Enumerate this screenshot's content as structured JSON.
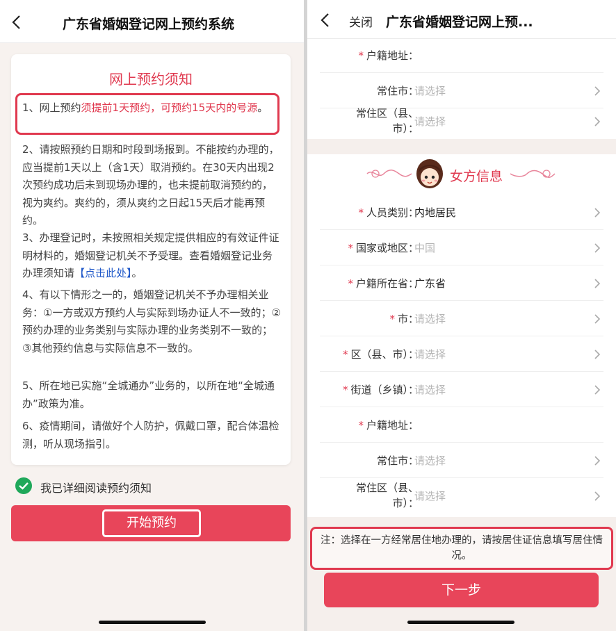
{
  "left": {
    "nav_title": "广东省婚姻登记网上预约系统",
    "notice_title": "网上预约须知",
    "rule1": {
      "prefix": "1、网上预约",
      "red1": "须提前1天预约",
      "comma": "，",
      "red2": "可预约15天内的号",
      "red3": "源",
      "suffix": "。"
    },
    "rule2": "2、请按照预约日期和时段到场报到。不能按约办理的，应当提前1天以上（含1天）取消预约。在30天内出现2次预约成功后未到现场办理的，也未提前取消预约的，视为爽约。爽约的，须从爽约之日起15天后才能再预约。",
    "rule3": {
      "text": "3、办理登记时，未按照相关规定提供相应的有效证件证明材料的，婚姻登记机关不予受理。查看婚姻登记业务办理须知请",
      "link": "【点击此处】",
      "end": "。"
    },
    "rule4": "4、有以下情形之一的，婚姻登记机关不予办理相关业务：①一方或双方预约人与实际到场办证人不一致的；②预约办理的业务类别与实际办理的业务类别不一致的；③其他预约信息与实际信息不一致的。",
    "rule5": "5、所在地已实施“全城通办”业务的，以所在地“全城通办”政策为准。",
    "rule6": "6、疫情期间，请做好个人防护，佩戴口罩，配合体温检测，听从现场指引。",
    "agree_text": "我已详细阅读预约须知",
    "start_button": "开始预约"
  },
  "right": {
    "close_label": "关闭",
    "nav_title": "广东省婚姻登记网上预...",
    "top_rows": [
      {
        "label": "户籍地址：",
        "required": "*",
        "value": "",
        "placeholder": false
      },
      {
        "label": "常住市：",
        "required": "",
        "value": "请选择",
        "placeholder": true
      },
      {
        "label_line1": "常住区（县、",
        "label_line2": "市）：",
        "required": "",
        "value": "请选择",
        "placeholder": true
      }
    ],
    "female_section_title": "女方信息",
    "female_rows": [
      {
        "label": "人员类别：",
        "required": "*",
        "value": "内地居民",
        "placeholder": false
      },
      {
        "label": "国家或地区：",
        "required": "*",
        "value": "中国",
        "placeholder": true
      },
      {
        "label": "户籍所在省：",
        "required": "*",
        "value": "广东省",
        "placeholder": false
      },
      {
        "label": "市：",
        "required": "*",
        "value": "请选择",
        "placeholder": true
      },
      {
        "label": "区（县、市）：",
        "required": "*",
        "value": "请选择",
        "placeholder": true
      },
      {
        "label": "街道（乡镇）：",
        "required": "*",
        "value": "请选择",
        "placeholder": true
      },
      {
        "label": "户籍地址：",
        "required": "*",
        "value": "",
        "placeholder": false
      },
      {
        "label": "常住市：",
        "required": "",
        "value": "请选择",
        "placeholder": true
      },
      {
        "label_line1": "常住区（县、",
        "label_line2": "市）：",
        "required": "",
        "value": "请选择",
        "placeholder": true
      }
    ],
    "note": "注：选择在一方经常居住地办理的，请按居住证信息填写居住情况。",
    "next_button": "下一步"
  },
  "colors": {
    "accent": "#e0394f",
    "button": "#e8455a",
    "check": "#1fa85a",
    "link": "#1f58c9"
  },
  "icons": [
    "back-arrow-icon",
    "check-circle-icon",
    "chevron-right-icon",
    "avatar-girl-icon",
    "ornament-swirl-icon"
  ]
}
